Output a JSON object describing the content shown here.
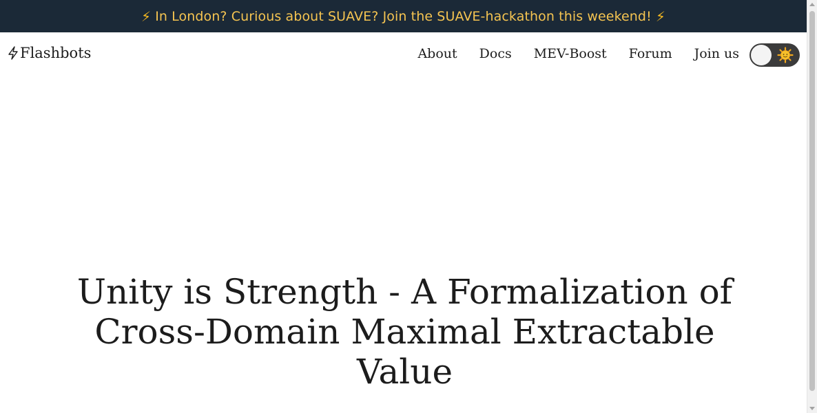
{
  "announcement": {
    "text": "In London? Curious about SUAVE? Join the SUAVE-hackathon this weekend!",
    "leading_icon": "lightning-bolt",
    "trailing_icon": "lightning-bolt",
    "background_color": "#1b2937",
    "text_color": "#f5c451"
  },
  "navbar": {
    "brand": {
      "icon": "lightning-bolt-outline",
      "name": "Flashbots"
    },
    "links": [
      {
        "label": "About"
      },
      {
        "label": "Docs"
      },
      {
        "label": "MEV-Boost"
      },
      {
        "label": "Forum"
      },
      {
        "label": "Join us"
      }
    ],
    "theme_toggle": {
      "icon": "sun-emoji",
      "state": "light"
    }
  },
  "hero": {
    "title": "Unity is Strength - A Formalization of Cross-Domain Maximal Extractable Value"
  }
}
